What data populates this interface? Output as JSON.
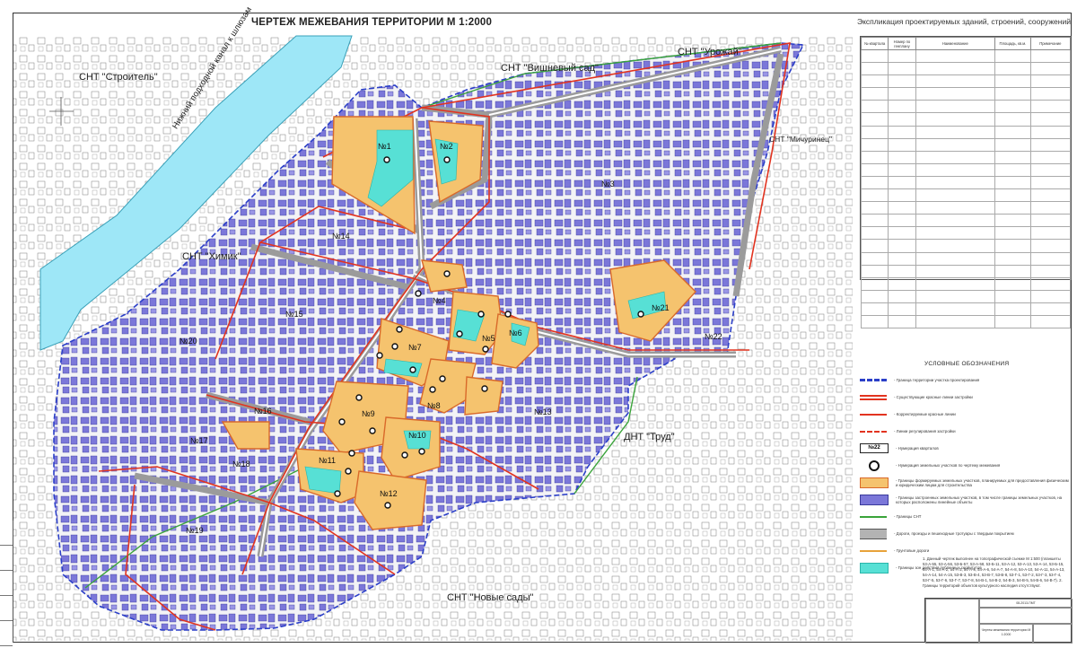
{
  "title": "ЧЕРТЕЖ МЕЖЕВАНИЯ ТЕРРИТОРИИ М 1:2000",
  "explication_title": "Экспликация проектируемых зданий, строений, сооружений",
  "explication_headers": [
    "№ квартала",
    "Номер по генплану",
    "Наименование",
    "Площадь, кв.м.",
    "Примечание"
  ],
  "explication_rows": 22,
  "legend_title": "УСЛОВНЫЕ ОБОЗНАЧЕНИЯ",
  "legend": [
    {
      "symbol": "boundary-blue-dash",
      "text": "- Граница территории участка проектирования"
    },
    {
      "symbol": "red-line-existing",
      "text": "- Существующие красные линии застройки"
    },
    {
      "symbol": "red-line-corrected",
      "text": "- Корректируемые красные линии"
    },
    {
      "symbol": "regulation-line",
      "text": "- Линии регулирования застройки"
    },
    {
      "symbol": "quarter-number",
      "label": "№22",
      "text": "- Нумерация кварталов"
    },
    {
      "symbol": "parcel-number",
      "text": "- Нумерация земельных участков по чертежу межевания"
    },
    {
      "symbol": "parcel-orange",
      "text": "- Границы формируемых земельных участков, планируемых для предоставления физическим и юридическим лицам для строительства"
    },
    {
      "symbol": "parcel-purple",
      "text": "- Границы застроенных земельных участков, в том числе границы земельных участков, на которых расположены линейные объекты"
    },
    {
      "symbol": "snt-green",
      "text": "- Границы СНТ"
    },
    {
      "symbol": "road",
      "text": "- Дороги, проезды и пешеходные тротуары с твердым покрытием"
    },
    {
      "symbol": "dirt-road",
      "text": "- Грунтовые дороги"
    },
    {
      "symbol": "servitude-cyan",
      "text": "- Границы зон действия публичных сервитутов"
    }
  ],
  "notes": "1. Данный чертеж выполнен на топографической съемке М 1:500 (планшеты 53-А-55, 53-А-56, 53-Б-57, 53-А-58, 53-Б-11, 53-А-12, 53-А-13, 53-А-14, 53-Б-15, 54-А-1, 54-А-2, 54-А-3, 54-А-5, 54-А-6, 54-А-7, 54-А-8, 54-А-10, 54-А-11, 54-А-13, 54-А-14, 54-А-15, 53-В-3, 53-В-4, 53-В-7, 53-В-8, 53-Г-1, 53-Г-2, 53-Г-3, 53-Г-4, 53-Г-5, 53-Г-6, 53-Г-7, 53-Г-8, 54-В-1, 54-В-2, 54-В-3, 54-В-5, 54-В-6, 54-В-7). 2. Границы территорий объектов культурного наследия отсутствуют.",
  "labels": {
    "snt_stroitel": "СНТ \"Строитель\"",
    "snt_vishnevy": "СНТ \"Вишневый сад\"",
    "snt_urozhai": "СНТ \"Урожай\"",
    "snt_michurinets": "СНТ \"Мичуринец\"",
    "snt_khimik": "СНТ \"Химик\"",
    "dnt_trud": "ДНТ \"Труд\"",
    "snt_novye_sady": "СНТ \"Новые сады\"",
    "canal": "Нижний подходной канал к шлюзам"
  },
  "quarters": [
    "№1",
    "№2",
    "№3",
    "№4",
    "№5",
    "№6",
    "№7",
    "№8",
    "№9",
    "№10",
    "№11",
    "№12",
    "№13",
    "№14",
    "№15",
    "№16",
    "№17",
    "№18",
    "№19",
    "№20",
    "№21",
    "№22"
  ],
  "colors": {
    "water": "#9ee7f7",
    "built": "#7b77d9",
    "parcel": "#f5c36e",
    "red_line": "#e2331f",
    "boundary": "#2b3fc8",
    "snt": "#3aa43a",
    "servitude": "#57e0d5",
    "road": "#b3b3b3"
  },
  "stamp": {
    "code": "08-2013-ПМТ",
    "sheet_name": "Чертеж межевания территории М 1:2000"
  }
}
